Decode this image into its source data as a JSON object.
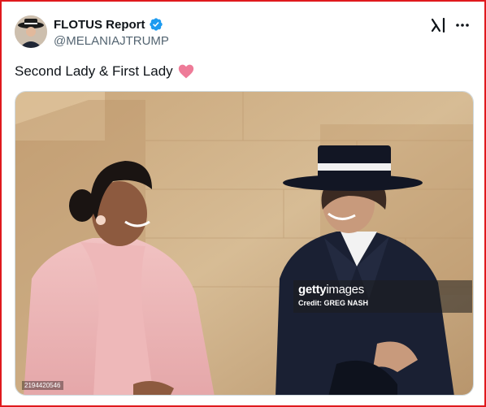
{
  "post": {
    "author": {
      "display_name": "FLOTUS Report",
      "handle": "@MELANIAJTRUMP",
      "verified": true,
      "avatar_icon": "avatar-photo"
    },
    "header_actions": {
      "grok_icon": "grok-icon",
      "more_icon": "more-horizontal-icon"
    },
    "text": "Second Lady & First Lady",
    "emoji": "pink-heart-icon",
    "image": {
      "watermark_logo_bold": "getty",
      "watermark_logo_light": "images",
      "watermark_credit": "Credit: GREG NASH",
      "image_id": "2194420546"
    }
  },
  "colors": {
    "frame_border": "#e0191d",
    "verified_blue": "#1d9bf0",
    "heart_pink": "#ee7b98",
    "text_primary": "#0f1419",
    "text_secondary": "#536471"
  }
}
